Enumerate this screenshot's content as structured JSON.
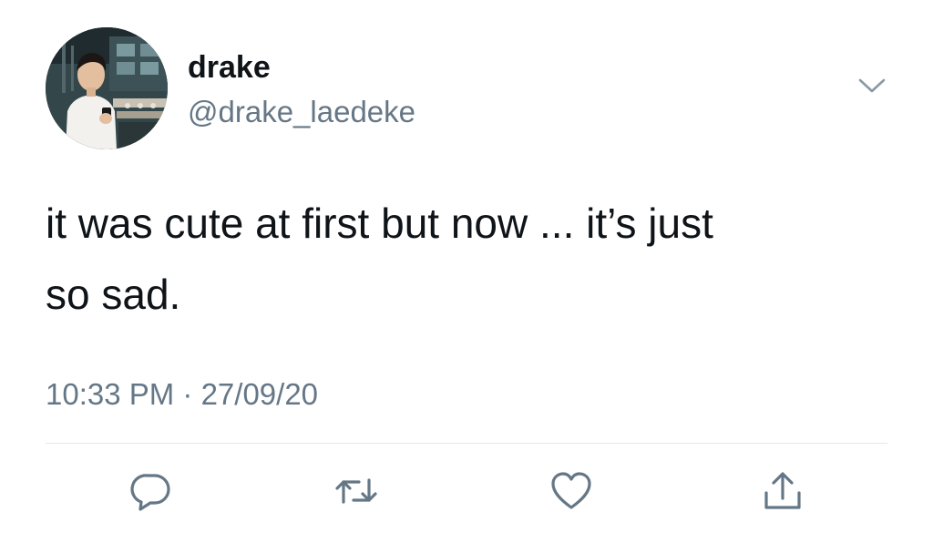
{
  "user": {
    "display_name": "drake",
    "handle": "@drake_laedeke"
  },
  "tweet": {
    "text_lines": [
      "it was cute at first but now ... it’s just",
      "so sad."
    ],
    "timestamp": "10:33 PM · 27/09/20"
  },
  "actions": {
    "reply_icon": "reply-icon",
    "retweet_icon": "retweet-icon",
    "like_icon": "heart-icon",
    "share_icon": "share-icon"
  },
  "colors": {
    "text_primary": "#0f1419",
    "text_secondary": "#657786",
    "icon": "#657786",
    "divider": "#e1e8ed"
  }
}
